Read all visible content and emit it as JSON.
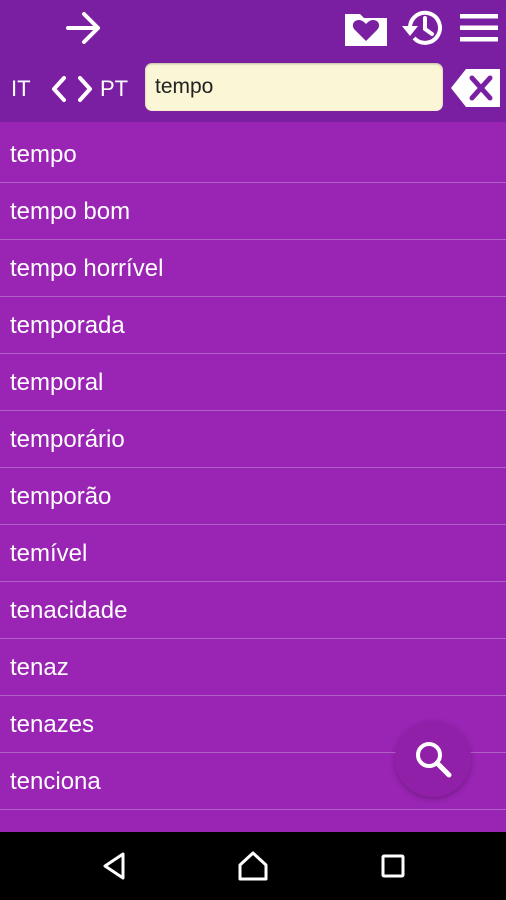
{
  "toolbar": {
    "back_icon": "arrow-right-icon",
    "favorites_icon": "folder-heart-icon",
    "history_icon": "history-icon",
    "menu_icon": "menu-icon"
  },
  "language": {
    "from": "IT",
    "to": "PT",
    "swap_icon": "swap-chevrons-icon"
  },
  "search": {
    "value": "tempo",
    "clear_icon": "backspace-x-icon"
  },
  "results": [
    "tempo",
    "tempo bom",
    "tempo horrível",
    "temporada",
    "temporal",
    "temporário",
    "temporão",
    "temível",
    "tenacidade",
    "tenaz",
    "tenazes",
    "tenciona"
  ],
  "fab": {
    "icon": "search-icon"
  },
  "system_nav": {
    "back_icon": "triangle-back-icon",
    "home_icon": "home-icon",
    "recents_icon": "square-recents-icon"
  },
  "colors": {
    "toolbar": "#7b1fa2",
    "background": "#9a24b4",
    "search_field": "#fbf6d6",
    "divider": "#b25fc7"
  }
}
